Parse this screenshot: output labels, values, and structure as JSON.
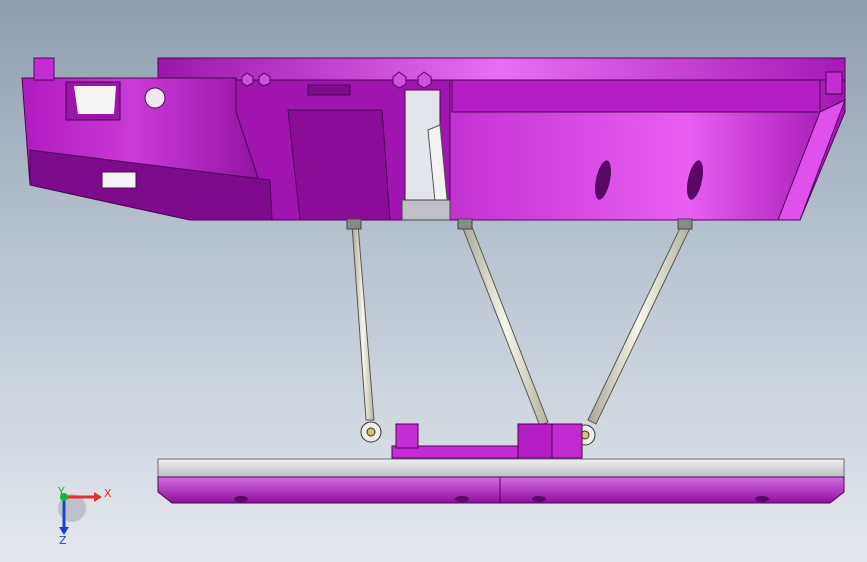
{
  "viewport": {
    "background_top": "#8e9db0",
    "background_bottom": "#e4e8ed"
  },
  "model": {
    "body_color": "#b01bc0",
    "highlight_color": "#e160ee",
    "shadow_color": "#6c0a78",
    "rod_color": "#e8e6d6",
    "plate_color": "#d4d4d8"
  },
  "triad": {
    "x_label": "X",
    "y_label": "Y",
    "z_label": "Z",
    "x_color": "#e03030",
    "y_color": "#20b040",
    "z_color": "#2040d0"
  }
}
